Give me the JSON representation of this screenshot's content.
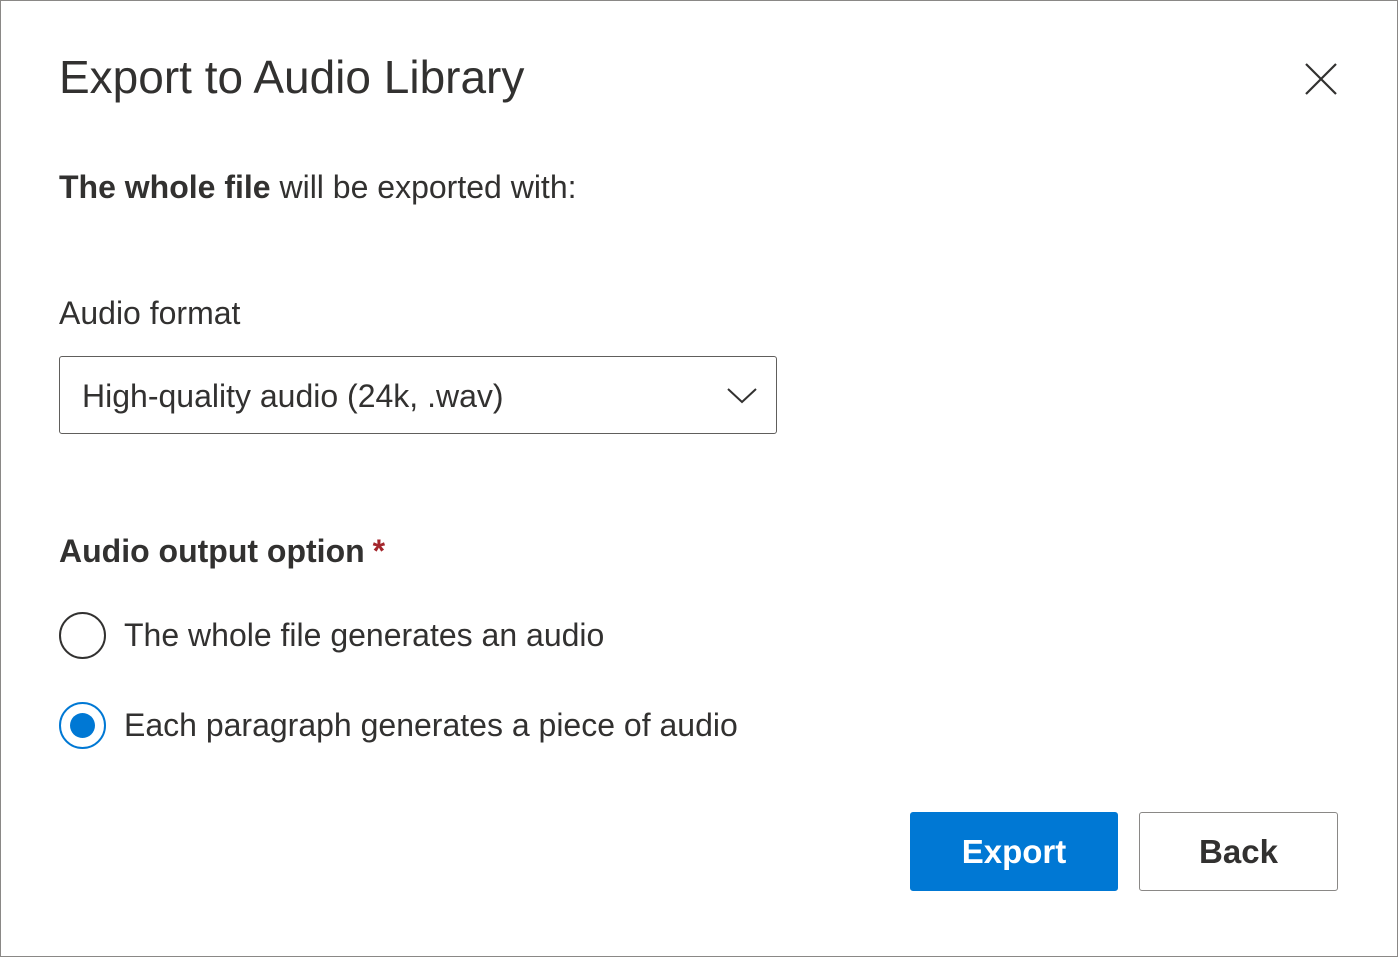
{
  "dialog": {
    "title": "Export to Audio Library",
    "close_icon": "close-icon"
  },
  "intro": {
    "bold": "The whole file",
    "rest": " will be exported with:"
  },
  "audio_format": {
    "label": "Audio format",
    "selected": "High-quality audio (24k, .wav)",
    "chevron_icon": "chevron-down-icon"
  },
  "output_option": {
    "label": "Audio output option",
    "required_marker": "*",
    "options": [
      {
        "label": "The whole file generates an audio",
        "checked": false
      },
      {
        "label": "Each paragraph generates a piece of audio",
        "checked": true
      }
    ]
  },
  "buttons": {
    "export": "Export",
    "back": "Back"
  },
  "colors": {
    "accent": "#0078d4",
    "required": "#a4262c",
    "text": "#323130"
  }
}
